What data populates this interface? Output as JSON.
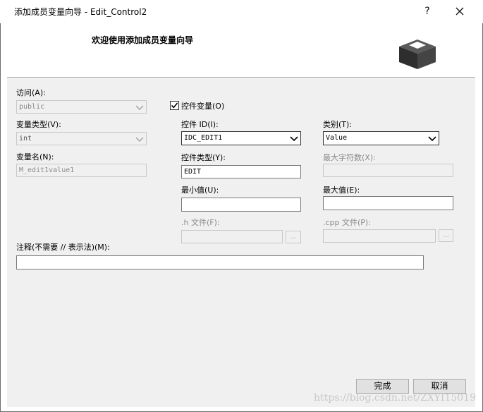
{
  "window": {
    "title": "添加成员变量向导 - Edit_Control2",
    "help_icon": "?",
    "close_icon": "×"
  },
  "header": {
    "welcome": "欢迎使用添加成员变量向导",
    "icon": "box-icon"
  },
  "access": {
    "label": "访问(A):",
    "value": "public"
  },
  "var_type": {
    "label": "变量类型(V):",
    "value": "int"
  },
  "var_name": {
    "label": "变量名(N):",
    "value": "M_edit1value1"
  },
  "control_var": {
    "label": "控件变量(O)",
    "checked": true
  },
  "control_id": {
    "label": "控件 ID(I):",
    "value": "IDC_EDIT1"
  },
  "category": {
    "label": "类别(T):",
    "value": "Value"
  },
  "control_type": {
    "label": "控件类型(Y):",
    "value": "EDIT"
  },
  "max_chars": {
    "label": "最大字符数(X):",
    "value": ""
  },
  "min_value": {
    "label": "最小值(U):",
    "value": ""
  },
  "max_value": {
    "label": "最大值(E):",
    "value": ""
  },
  "h_file": {
    "label": ".h 文件(F):",
    "value": "",
    "browse": "..."
  },
  "cpp_file": {
    "label": ".cpp 文件(P):",
    "value": "",
    "browse": "..."
  },
  "comment": {
    "label": "注释(不需要 // 表示法)(M):",
    "value": ""
  },
  "buttons": {
    "finish": "完成",
    "cancel": "取消"
  },
  "watermark": "https://blog.csdn.net/ZXYI15019"
}
